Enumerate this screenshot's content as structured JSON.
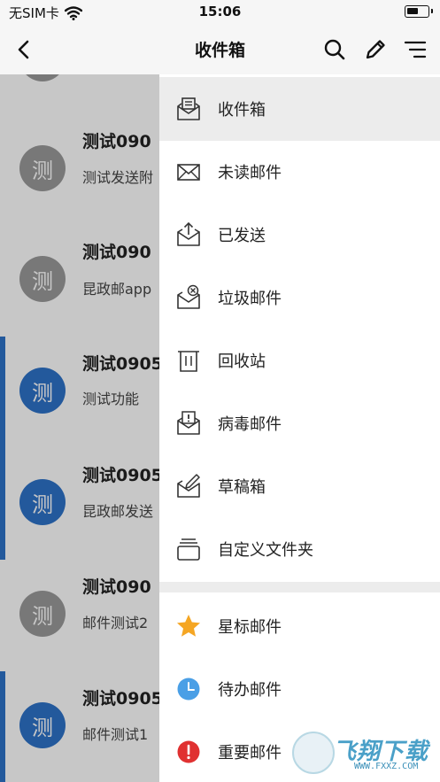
{
  "status_bar": {
    "carrier": "无SIM卡",
    "time": "15:06"
  },
  "nav": {
    "title": "收件箱",
    "icons": [
      "back-icon",
      "search-icon",
      "compose-icon",
      "menu-icon"
    ]
  },
  "mail_list": [
    {
      "sender": "测试090",
      "preview": "测试发送附",
      "avatar": "测",
      "unread": false
    },
    {
      "sender": "测试090",
      "preview": "昆政邮app",
      "avatar": "测",
      "unread": false
    },
    {
      "sender": "测试0905",
      "preview": "测试功能",
      "avatar": "测",
      "unread": true
    },
    {
      "sender": "测试0905",
      "preview": "昆政邮发送",
      "avatar": "测",
      "unread": true
    },
    {
      "sender": "测试090",
      "preview": "邮件测试2",
      "avatar": "测",
      "unread": false
    },
    {
      "sender": "测试0905",
      "preview": "邮件测试1",
      "avatar": "测",
      "unread": true
    }
  ],
  "drawer": {
    "folders": [
      {
        "label": "收件箱",
        "icon": "inbox-icon"
      },
      {
        "label": "未读邮件",
        "icon": "unread-mail-icon"
      },
      {
        "label": "已发送",
        "icon": "sent-icon"
      },
      {
        "label": "垃圾邮件",
        "icon": "spam-icon"
      },
      {
        "label": "回收站",
        "icon": "trash-icon"
      },
      {
        "label": "病毒邮件",
        "icon": "virus-mail-icon"
      },
      {
        "label": "草稿箱",
        "icon": "draft-icon"
      },
      {
        "label": "自定义文件夹",
        "icon": "custom-folder-icon"
      }
    ],
    "labels": [
      {
        "label": "星标邮件",
        "icon": "star-icon"
      },
      {
        "label": "待办邮件",
        "icon": "clock-icon"
      },
      {
        "label": "重要邮件",
        "icon": "important-icon"
      }
    ]
  },
  "colors": {
    "accent": "#2e72c8",
    "star": "#f5a623",
    "todo": "#4a9fe6",
    "important": "#e03131"
  },
  "watermark": {
    "text": "飞翔下载",
    "url": "WWW.FXXZ.COM"
  }
}
